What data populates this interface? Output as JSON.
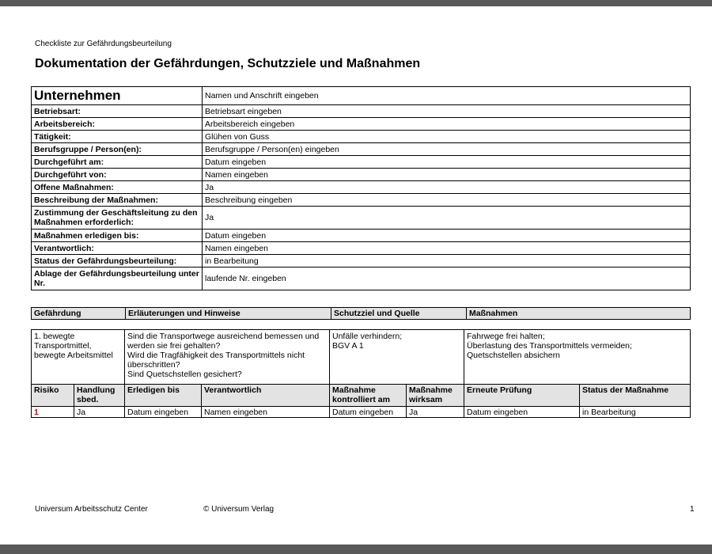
{
  "doc": {
    "header": "Checkliste zur Gefährdungsbeurteilung",
    "title": "Dokumentation der Gefährdungen, Schutzziele und Maßnahmen"
  },
  "company": {
    "label": "Unternehmen",
    "value": "Namen und Anschrift eingeben"
  },
  "info_rows": [
    {
      "label": "Betriebsart:",
      "value": "Betriebsart eingeben"
    },
    {
      "label": "Arbeitsbereich:",
      "value": "Arbeitsbereich eingeben"
    },
    {
      "label": "Tätigkeit:",
      "value": "Glühen von Guss"
    },
    {
      "label": "Berufsgruppe / Person(en):",
      "value": "Berufsgruppe / Person(en) eingeben"
    },
    {
      "label": "Durchgeführt am:",
      "value": "Datum eingeben"
    },
    {
      "label": "Durchgeführt von:",
      "value": "Namen eingeben"
    },
    {
      "label": "Offene Maßnahmen:",
      "value": "Ja"
    },
    {
      "label": "Beschreibung der Maßnahmen:",
      "value": "Beschreibung eingeben"
    },
    {
      "label": "Zustimmung der Geschäftsleitung zu den Maßnahmen erforderlich:",
      "value": "Ja"
    },
    {
      "label": "Maßnahmen erledigen bis:",
      "value": "Datum eingeben"
    },
    {
      "label": "Verantwortlich:",
      "value": "Namen eingeben"
    },
    {
      "label": "Status der Gefährdungsbeurteilung:",
      "value": "in Bearbeitung"
    },
    {
      "label": "Ablage der Gefährdungsbeurteilung unter Nr.",
      "value": "laufende Nr. eingeben"
    }
  ],
  "section_headers": [
    "Gefährdung",
    "Erläuterungen und Hinweise",
    "Schutzziel und Quelle",
    "Maßnahmen"
  ],
  "hazard": {
    "name": "1. bewegte Transportmittel, bewegte Arbeitsmittel",
    "notes": "Sind die Transportwege ausreichend bemessen und werden sie frei gehalten?\nWird die Tragfähigkeit des Transportmittels nicht überschritten?\nSind Quetschstellen gesichert?",
    "goal": "Unfälle verhindern;\nBGV A 1",
    "measures": "Fahrwege frei halten;\nÜberlastung des Transportmittels vermeiden;\nQuetschstellen absichern"
  },
  "sub_headers": [
    "Risiko",
    "Handlung sbed.",
    "Erledigen bis",
    "Verantwortlich",
    "Maßnahme kontrolliert am",
    "Maßnahme wirksam",
    "Erneute Prüfung",
    "Status der Maßnahme"
  ],
  "sub_values": [
    "1",
    "Ja",
    "Datum eingeben",
    "Namen eingeben",
    "Datum eingeben",
    "Ja",
    "Datum eingeben",
    "in Bearbeitung"
  ],
  "footer": {
    "left": "Universum Arbeitsschutz Center",
    "center": "© Universum Verlag",
    "page": "1"
  },
  "colors": {
    "risk": "#d40000",
    "header_bg": "#e3e3e3",
    "frame": "#595959"
  }
}
